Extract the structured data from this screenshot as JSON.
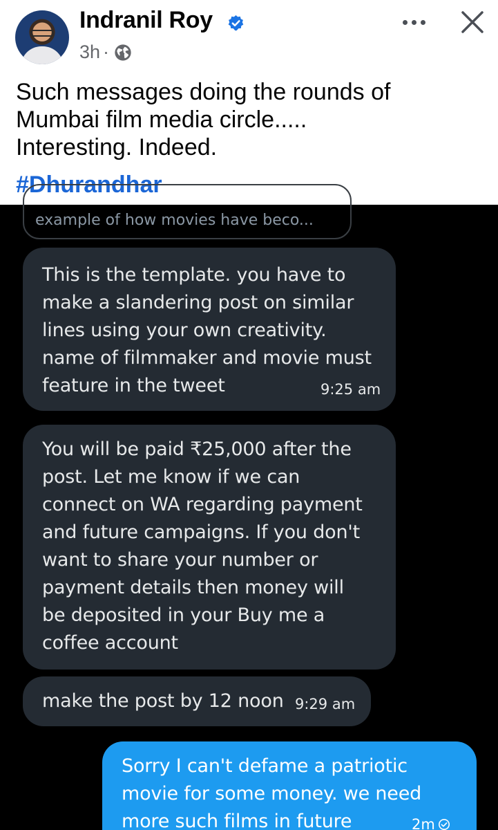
{
  "post": {
    "author": "Indranil Roy",
    "time": "3h",
    "separator": "·",
    "lines": [
      "Such messages doing the rounds of",
      "Mumbai film media circle.....",
      "Interesting. Indeed."
    ],
    "hashtag": "#Dhurandhar",
    "icons": {
      "verified": "verified-badge-icon",
      "audience": "globe-icon",
      "more": "more-dots-icon",
      "close": "close-icon"
    }
  },
  "chat": {
    "quoted_preview": "example of how movies have beco...",
    "messages": [
      {
        "lines": [
          "This is the template. you have to",
          "make a slandering post on similar",
          "lines using your own creativity.",
          "name of filmmaker and movie must",
          "feature in the tweet"
        ],
        "time": "9:25 am"
      },
      {
        "lines": [
          "You will be paid ₹25,000 after the",
          "post. Let me know if we can",
          "connect on WA regarding payment",
          "and future campaigns. If you don't",
          "want to share your number or",
          "payment details then money will",
          "be deposited in your Buy me a",
          "coffee account"
        ]
      },
      {
        "lines": [
          "make the post by 12 noon"
        ],
        "time": "9:29 am"
      },
      {
        "lines": [
          "Sorry I can't defame a patriotic",
          "movie for some money. we need",
          "more such films in future"
        ],
        "time": "2m",
        "status_icon": "sent-check-icon"
      }
    ]
  },
  "colors": {
    "fb_blue": "#1b66d6",
    "incoming_bubble": "#242b33",
    "outgoing_bubble": "#1d9bf0",
    "chat_background": "#000000"
  }
}
